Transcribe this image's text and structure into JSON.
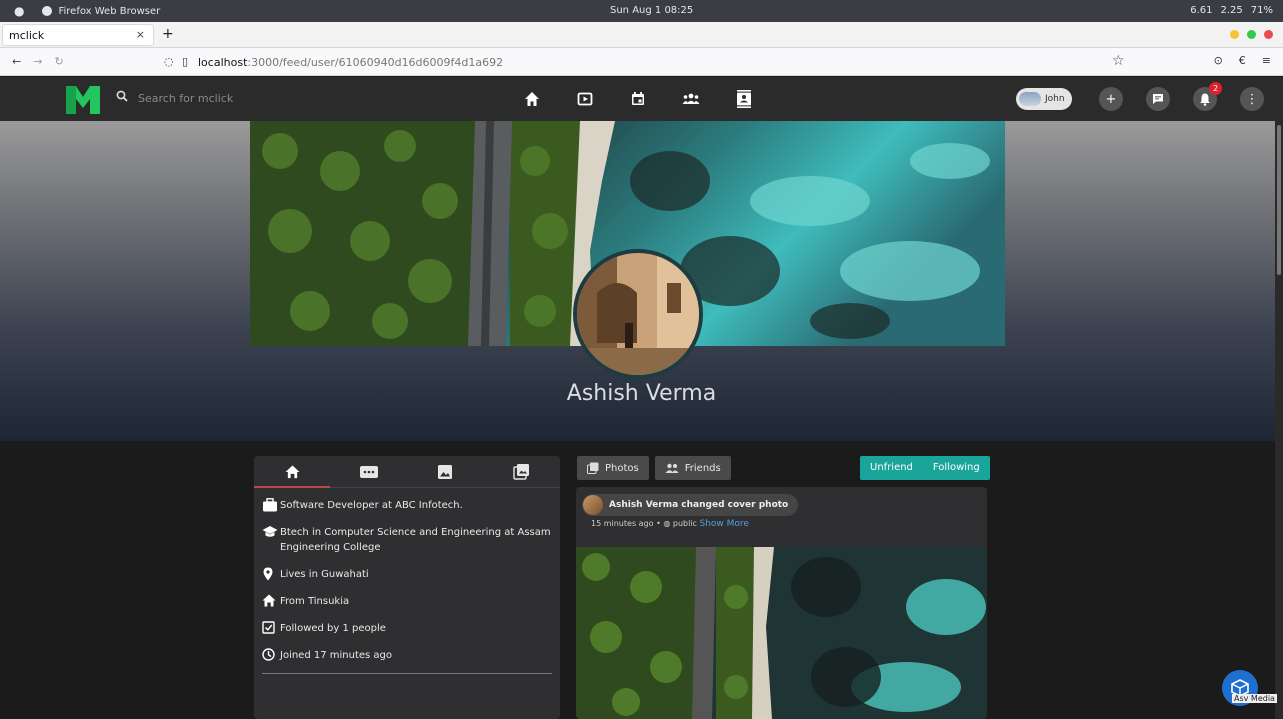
{
  "system": {
    "app_name": "Firefox Web Browser",
    "clock": "Sun Aug 1  08:25",
    "stats": [
      "6.61",
      "2.25",
      "71%"
    ]
  },
  "browser": {
    "tab_title": "mclick",
    "tab_close": "×",
    "new_tab": "+",
    "url_host": "localhost",
    "url_path": ":3000/feed/user/61060940d16d6009f4d1a692"
  },
  "app": {
    "search_placeholder": "Search for mclick",
    "user_name": "John",
    "notification_count": "2",
    "brand_color": "#22c55e",
    "nav_icons": [
      "home-icon",
      "video-icon",
      "calendar-icon",
      "groups-icon",
      "contacts-icon"
    ]
  },
  "profile": {
    "name": "Ashish Verma"
  },
  "about": {
    "work": "Software Developer at ABC Infotech.",
    "education": "Btech in Computer Science and Engineering at Assam Engineering College",
    "lives": "Lives in Guwahati",
    "from": "From Tinsukia",
    "followers": "Followed by 1 people",
    "joined": "Joined 17 minutes ago"
  },
  "tabs": {
    "photos": "Photos",
    "friends": "Friends"
  },
  "actions": {
    "unfriend": "Unfriend",
    "following": "Following",
    "color": "#1aa59a"
  },
  "post": {
    "title": "Ashish Verma changed cover photo",
    "time": "15 minutes ago • ",
    "visibility": "public",
    "show_more": "Show More"
  },
  "watermark": {
    "label": "Asv Media"
  }
}
